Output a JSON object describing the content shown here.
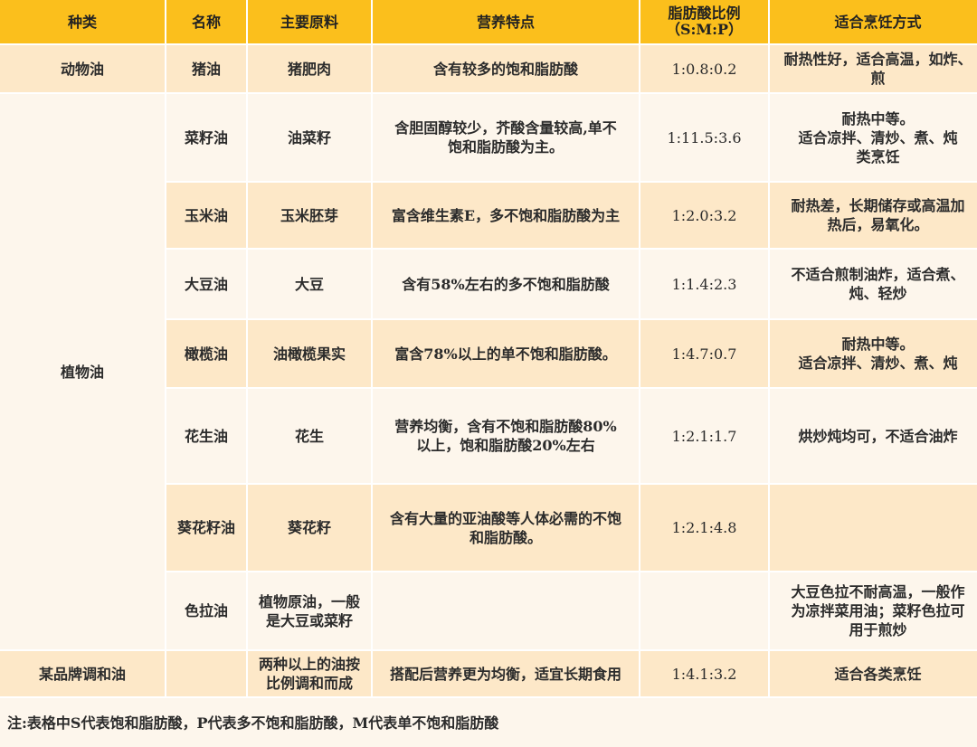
{
  "headers": {
    "category": "种类",
    "name": "名称",
    "material": "主要原料",
    "nutrition": "营养特点",
    "ratio": "脂肪酸比例\n（S:M:P）",
    "cooking": "适合烹饪方式"
  },
  "groups": {
    "animal": "动物油",
    "plant": "植物油"
  },
  "rows": [
    {
      "name": "猪油",
      "material": "猪肥肉",
      "nutrition": "含有较多的饱和脂肪酸",
      "ratio": "1:0.8:0.2",
      "cooking": "耐热性好，适合高温，如炸、\n煎"
    },
    {
      "name": "菜籽油",
      "material": "油菜籽",
      "nutrition": "含胆固醇较少，芥酸含量较高,单不\n饱和脂肪酸为主。",
      "ratio": "1:11.5:3.6",
      "cooking": "耐热中等。\n适合凉拌、清炒、煮、炖\n类烹饪"
    },
    {
      "name": "玉米油",
      "material": "玉米胚芽",
      "nutrition": "富含维生素E，多不饱和脂肪酸为主",
      "ratio": "1:2.0:3.2",
      "cooking": "耐热差，长期储存或高温加\n热后，易氧化。"
    },
    {
      "name": "大豆油",
      "material": "大豆",
      "nutrition": "含有58%左右的多不饱和脂肪酸",
      "ratio": "1:1.4:2.3",
      "cooking": "不适合煎制油炸，适合煮、\n炖、轻炒"
    },
    {
      "name": "橄榄油",
      "material": "油橄榄果实",
      "nutrition": "富含78%以上的单不饱和脂肪酸。",
      "ratio": "1:4.7:0.7",
      "cooking": "耐热中等。\n适合凉拌、清炒、煮、炖"
    },
    {
      "name": "花生油",
      "material": "花生",
      "nutrition": "营养均衡，含有不饱和脂肪酸80%\n以上，饱和脂肪酸20%左右",
      "ratio": "1:2.1:1.7",
      "cooking": "烘炒炖均可，不适合油炸"
    },
    {
      "name": "葵花籽油",
      "material": "葵花籽",
      "nutrition": "含有大量的亚油酸等人体必需的不饱\n和脂肪酸。",
      "ratio": "1:2.1:4.8",
      "cooking": ""
    },
    {
      "name": "色拉油",
      "material": "植物原油，一般\n是大豆或菜籽",
      "nutrition": "",
      "ratio": "",
      "cooking": "大豆色拉不耐高温，一般作\n为凉拌菜用油；菜籽色拉可\n用于煎炒"
    }
  ],
  "blend": {
    "category": "某品牌调和油",
    "name": "",
    "material": "两种以上的油按\n比例调和而成",
    "nutrition": "搭配后营养更为均衡，适宜长期食用",
    "ratio": "1:4.1:3.2",
    "cooking": "适合各类烹饪"
  },
  "note": "注:表格中S代表饱和脂肪酸，P代表多不饱和脂肪酸，M代表单不饱和脂肪酸",
  "colors": {
    "header_bg": "#fbbf1c",
    "row_highlight": "#fde8c8",
    "row_light": "#fdf6ec"
  }
}
